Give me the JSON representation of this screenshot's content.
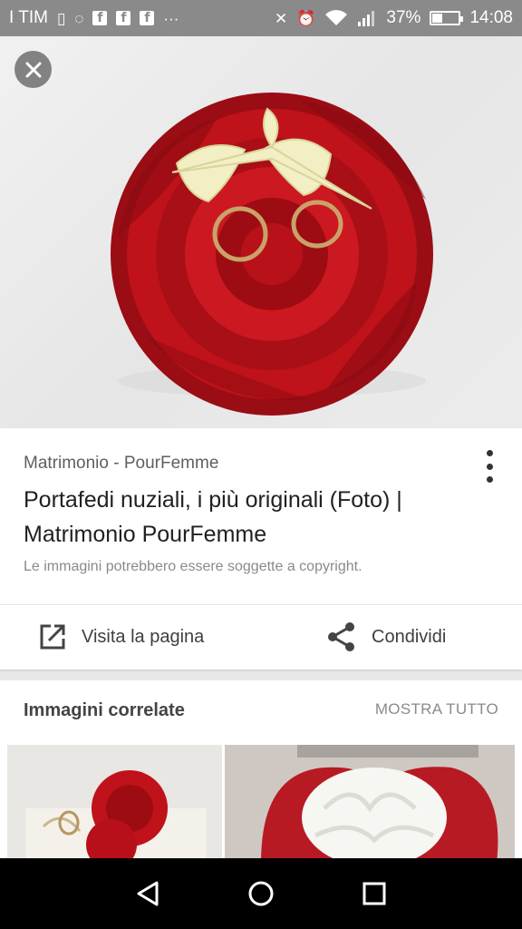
{
  "status_bar": {
    "carrier": "I TIM",
    "battery_percent": "37%",
    "battery_level": 0.37,
    "time": "14:08"
  },
  "hero": {
    "close_icon": "close-icon",
    "image_subject": "red-rose-ring-pillow"
  },
  "result": {
    "source": "Matrimonio - PourFemme",
    "title": "Portafedi nuziali, i più originali (Foto) | Matrimonio PourFemme",
    "copyright_note": "Le immagini potrebbero essere soggette a copyright."
  },
  "actions": {
    "visit_label": "Visita la pagina",
    "share_label": "Condividi"
  },
  "related": {
    "title": "Immagini correlate",
    "show_all": "MOSTRA TUTTO"
  },
  "colors": {
    "status_bar": "#8a8a8a",
    "rose_red": "#c0121a",
    "ribbon": "#f2efc4",
    "nav_bar": "#000000"
  }
}
